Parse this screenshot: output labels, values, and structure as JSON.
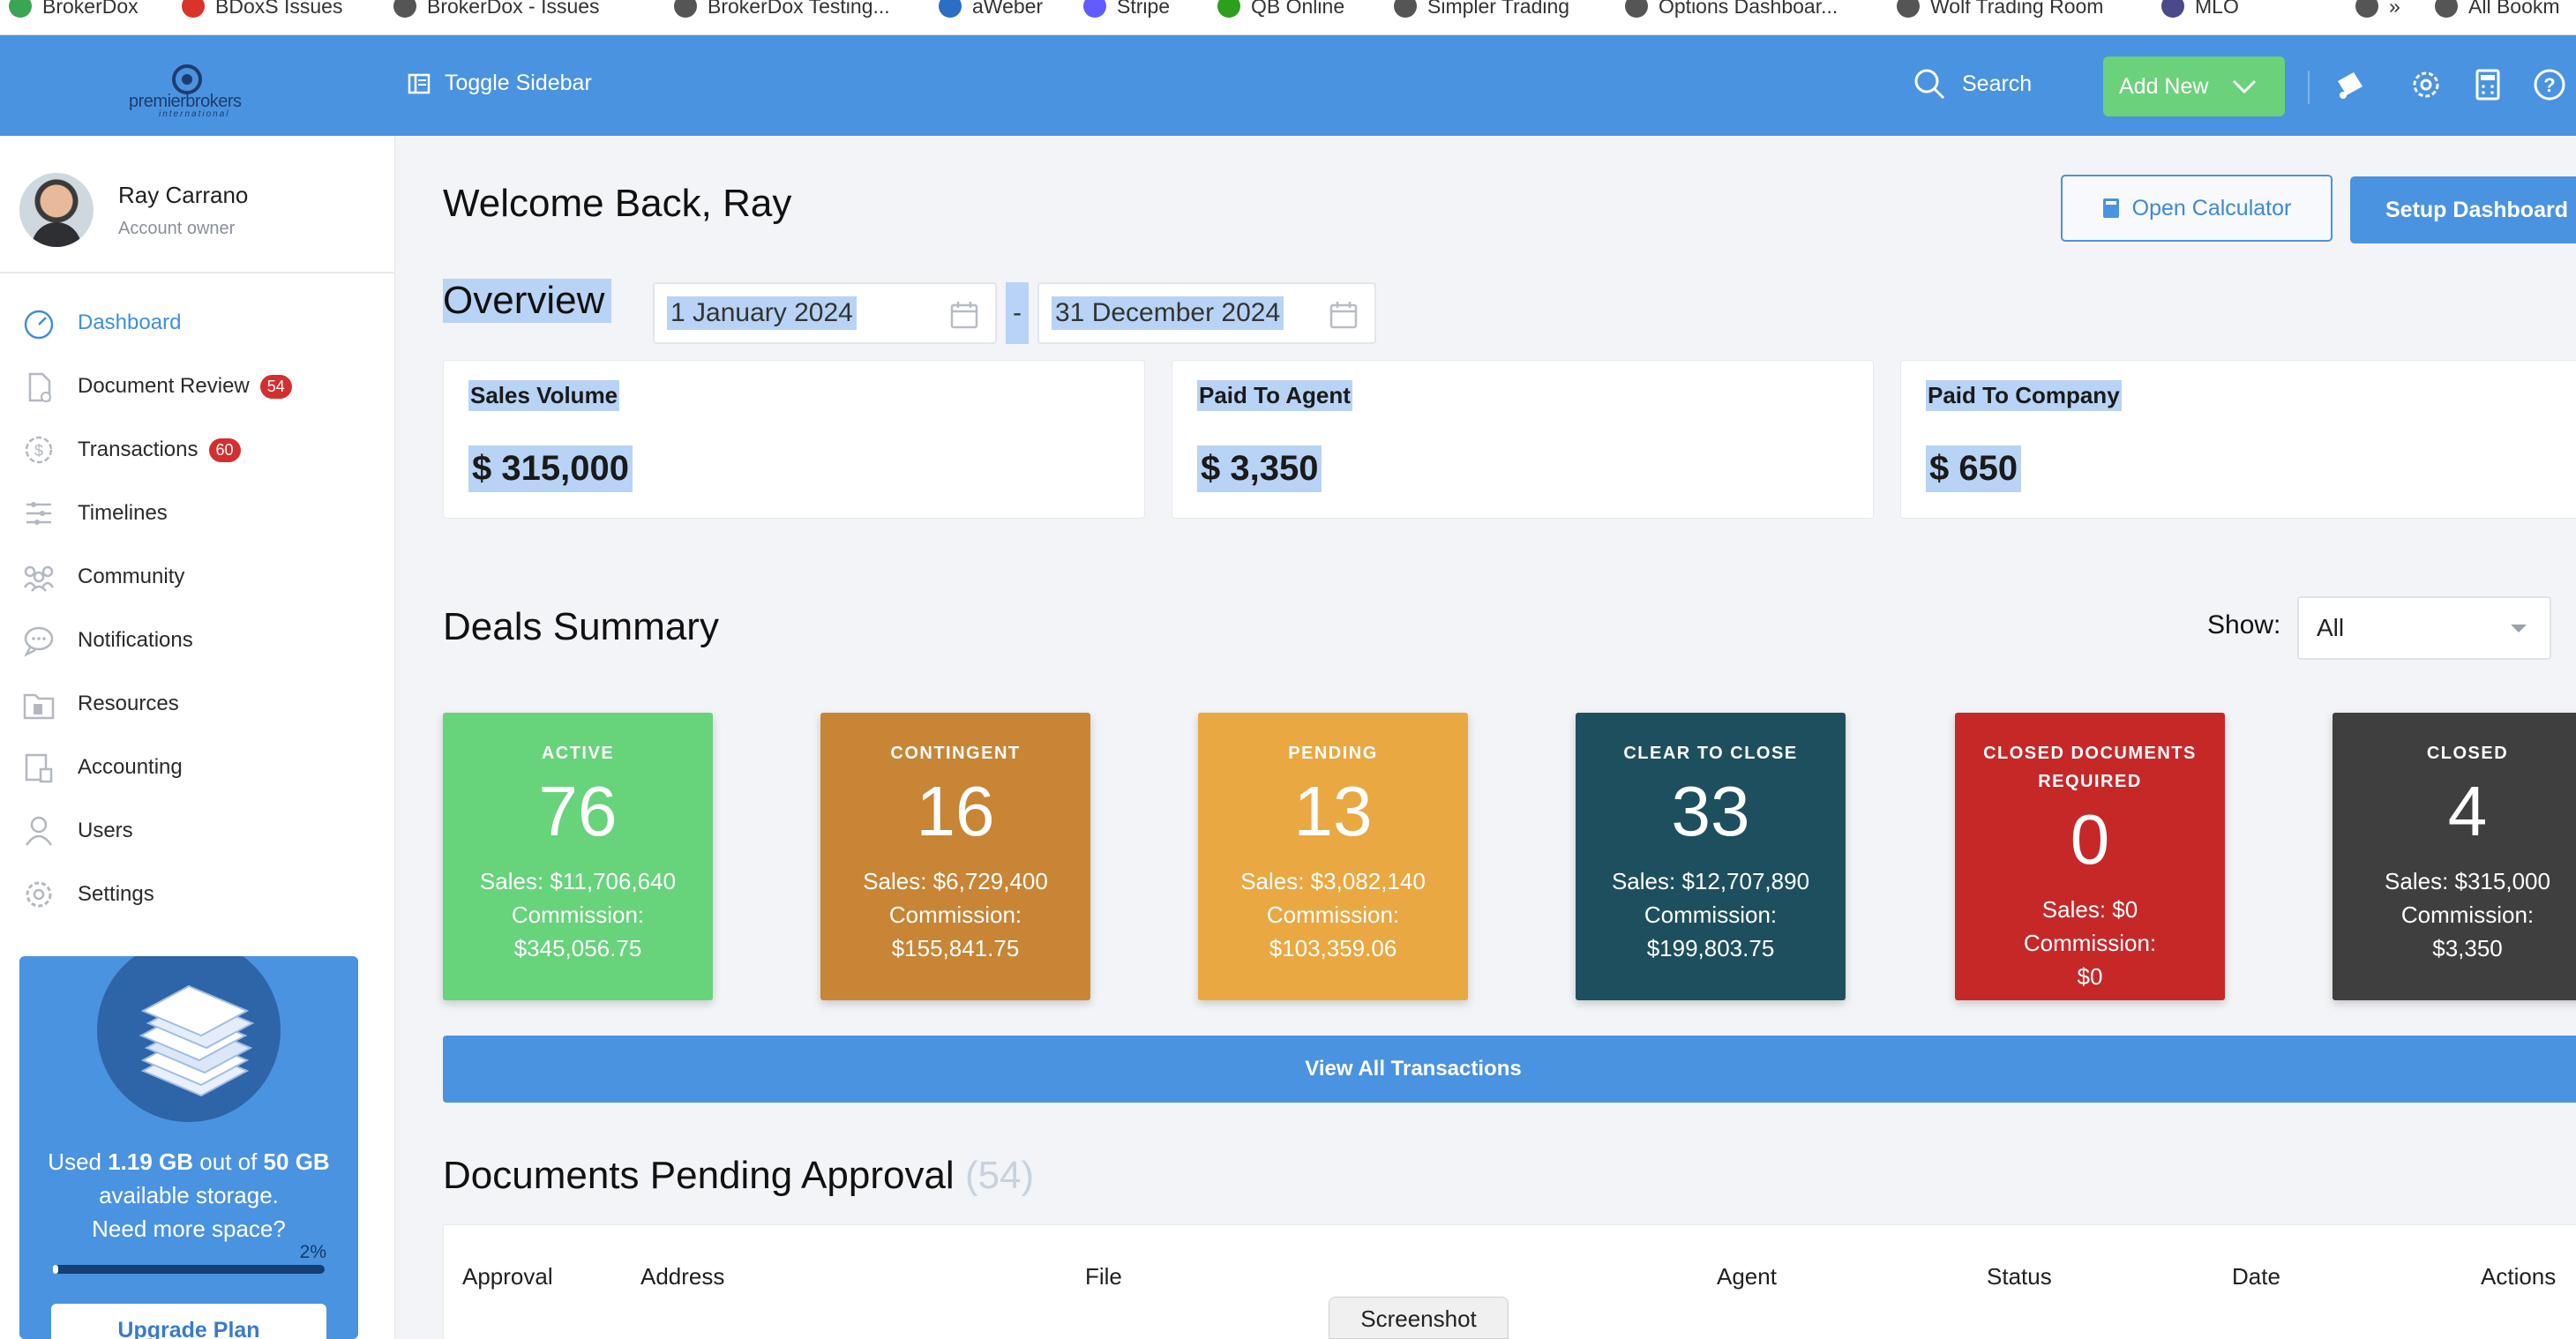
{
  "bookmarks": [
    {
      "label": "BrokerDox",
      "color": "#3aa655"
    },
    {
      "label": "BDoxS Issues",
      "color": "#d9342b"
    },
    {
      "label": "BrokerDox - Issues",
      "color": "#555555"
    },
    {
      "label": "BrokerDox Testing...",
      "color": "#555555"
    },
    {
      "label": "aWeber",
      "color": "#2a6ec6"
    },
    {
      "label": "Stripe",
      "color": "#635bff"
    },
    {
      "label": "QB Online",
      "color": "#2ca01c"
    },
    {
      "label": "Simpler Trading",
      "color": "#555555"
    },
    {
      "label": "Options Dashboar...",
      "color": "#555555"
    },
    {
      "label": "Wolf Trading Room",
      "color": "#555555"
    },
    {
      "label": "MLO",
      "color": "#4a4a8a"
    },
    {
      "label": "»",
      "color": "#555555"
    },
    {
      "label": "All Bookm",
      "color": "#555555"
    }
  ],
  "header": {
    "logo_text": "premierbrokers",
    "logo_sub": "international",
    "toggle_label": "Toggle Sidebar",
    "search_label": "Search",
    "add_new_label": "Add New",
    "icons": [
      "bell-icon",
      "gear-icon",
      "calculator-icon",
      "help-icon"
    ]
  },
  "profile": {
    "name": "Ray Carrano",
    "role": "Account owner"
  },
  "nav": [
    {
      "label": "Dashboard",
      "icon": "dashboard-icon",
      "active": true,
      "badge": ""
    },
    {
      "label": "Document Review",
      "icon": "document-icon",
      "active": false,
      "badge": "54"
    },
    {
      "label": "Transactions",
      "icon": "dollar-icon",
      "active": false,
      "badge": "60"
    },
    {
      "label": "Timelines",
      "icon": "timeline-icon",
      "active": false,
      "badge": ""
    },
    {
      "label": "Community",
      "icon": "community-icon",
      "active": false,
      "badge": ""
    },
    {
      "label": "Notifications",
      "icon": "chat-icon",
      "active": false,
      "badge": ""
    },
    {
      "label": "Resources",
      "icon": "folder-icon",
      "active": false,
      "badge": ""
    },
    {
      "label": "Accounting",
      "icon": "accounting-icon",
      "active": false,
      "badge": ""
    },
    {
      "label": "Users",
      "icon": "user-icon",
      "active": false,
      "badge": ""
    },
    {
      "label": "Settings",
      "icon": "gear-icon",
      "active": false,
      "badge": ""
    }
  ],
  "storage": {
    "used": "1.19 GB",
    "total": "50 GB",
    "percent_label": "2%",
    "percent": 0.02,
    "line1_pre": "Used ",
    "line1_mid": " out of ",
    "line2_post": " available storage.",
    "line3": "Need more space?",
    "upgrade_label": "Upgrade Plan"
  },
  "main": {
    "welcome": "Welcome Back, Ray",
    "open_calculator": "Open Calculator",
    "setup_dashboard": "Setup Dashboard",
    "overview": "Overview",
    "date_from": "1 January 2024",
    "date_sep": "-",
    "date_to": "31 December 2024"
  },
  "stats": [
    {
      "label": "Sales Volume",
      "value": "$ 315,000"
    },
    {
      "label": "Paid To Agent",
      "value": "$ 3,350"
    },
    {
      "label": "Paid To Company",
      "value": "$ 650"
    }
  ],
  "deals": {
    "title": "Deals Summary",
    "show_label": "Show:",
    "show_value": "All",
    "cards": [
      {
        "title": "ACTIVE",
        "count": "76",
        "sales": "Sales: $11,706,640",
        "commission_label": "Commission:",
        "commission": "$345,056.75",
        "color": "#67d37b"
      },
      {
        "title": "CONTINGENT",
        "count": "16",
        "sales": "Sales: $6,729,400",
        "commission_label": "Commission:",
        "commission": "$155,841.75",
        "color": "#c88535"
      },
      {
        "title": "PENDING",
        "count": "13",
        "sales": "Sales: $3,082,140",
        "commission_label": "Commission:",
        "commission": "$103,359.06",
        "color": "#eaa842"
      },
      {
        "title": "CLEAR TO CLOSE",
        "count": "33",
        "sales": "Sales: $12,707,890",
        "commission_label": "Commission:",
        "commission": "$199,803.75",
        "color": "#1e4f5e"
      },
      {
        "title": "CLOSED DOCUMENTS REQUIRED",
        "count": "0",
        "sales": "Sales: $0",
        "commission_label": "Commission:",
        "commission": "$0",
        "color": "#c62828"
      },
      {
        "title": "CLOSED",
        "count": "4",
        "sales": "Sales: $315,000",
        "commission_label": "Commission:",
        "commission": "$3,350",
        "color": "#3f3f3f"
      }
    ],
    "view_all": "View All Transactions"
  },
  "documents": {
    "title": "Documents Pending Approval",
    "count": "(54)",
    "columns": [
      "Approval",
      "Address",
      "File",
      "Agent",
      "Status",
      "Date",
      "Actions"
    ]
  },
  "tooltip": "Screenshot"
}
